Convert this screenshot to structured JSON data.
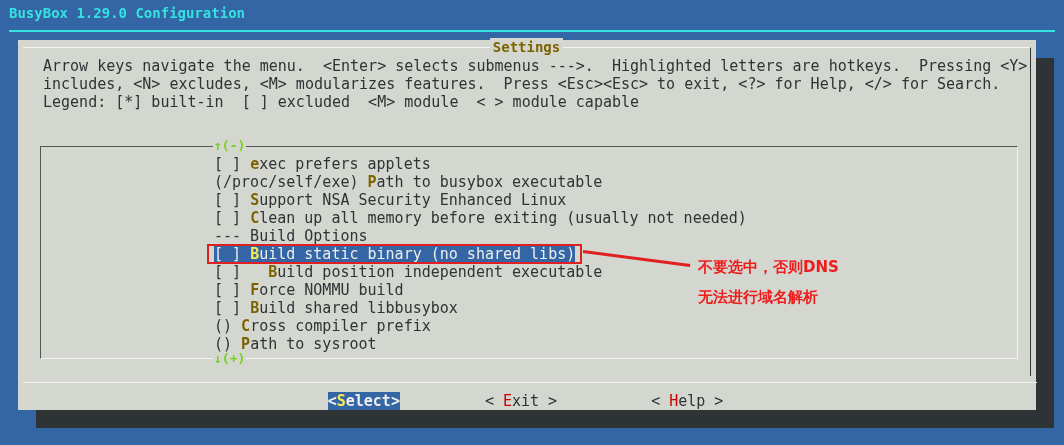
{
  "window": {
    "title": "BusyBox 1.29.0 Configuration"
  },
  "dialog": {
    "title": "Settings",
    "help_lines": [
      "Arrow keys navigate the menu.  <Enter> selects submenus --->.  Highlighted letters are hotkeys.  Pressing <Y>",
      "includes, <N> excludes, <M> modularizes features.  Press <Esc><Esc> to exit, <?> for Help, </> for Search.",
      "Legend: [*] built-in  [ ] excluded  <M> module  < > module capable"
    ],
    "menu": {
      "scroll_up": "↑(-)",
      "scroll_down": "↓(+)",
      "items": [
        {
          "kind": "option",
          "prefix": "[ ]",
          "hotkey": "e",
          "label": "xec prefers applets",
          "selected": false
        },
        {
          "kind": "option",
          "prefix": "(/proc/self/exe)",
          "hotkey": "P",
          "label": "ath to busybox executable",
          "selected": false
        },
        {
          "kind": "option",
          "prefix": "[ ]",
          "hotkey": "S",
          "label": "upport NSA Security Enhanced Linux",
          "selected": false
        },
        {
          "kind": "option",
          "prefix": "[ ]",
          "hotkey": "C",
          "label": "lean up all memory before exiting (usually not needed)",
          "selected": false
        },
        {
          "kind": "comment",
          "label": "--- Build Options"
        },
        {
          "kind": "option",
          "prefix": "[ ]",
          "hotkey": "B",
          "label": "uild static binary (no shared libs)",
          "selected": true,
          "children": [
            {
              "kind": "option",
              "prefix": "[ ]",
              "hotkey": "B",
              "label": "uild position independent executable",
              "selected": false
            }
          ]
        },
        {
          "kind": "option",
          "prefix": "[ ]",
          "hotkey": "F",
          "label": "orce NOMMU build",
          "selected": false
        },
        {
          "kind": "option",
          "prefix": "[ ]",
          "hotkey": "B",
          "label": "uild shared libbusybox",
          "selected": false
        },
        {
          "kind": "option",
          "prefix": "()",
          "hotkey": "C",
          "label": "ross compiler prefix",
          "selected": false
        },
        {
          "kind": "option",
          "prefix": "()",
          "hotkey": "P",
          "label": "ath to sysroot",
          "selected": false
        }
      ]
    },
    "buttons": [
      {
        "open": "<",
        "hotkey": "S",
        "label": "elect",
        "close": ">",
        "selected": true
      },
      {
        "open": "<",
        "hotkey": "E",
        "label": "xit",
        "close": ">",
        "selected": false
      },
      {
        "open": "<",
        "hotkey": "H",
        "label": "elp",
        "close": ">",
        "selected": false
      }
    ]
  },
  "annotation": {
    "lines": [
      "不要选中，否则DNS",
      "无法进行域名解析"
    ]
  }
}
